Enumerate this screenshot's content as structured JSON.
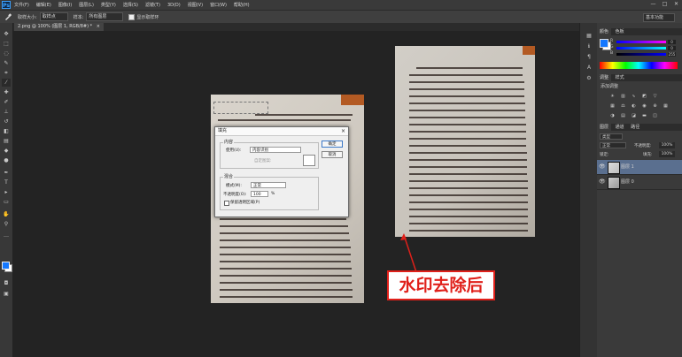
{
  "app": {
    "logo": "Ps"
  },
  "menubar": [
    "文件(F)",
    "编辑(E)",
    "图像(I)",
    "图层(L)",
    "类型(Y)",
    "选择(S)",
    "滤镜(T)",
    "3D(D)",
    "视图(V)",
    "窗口(W)",
    "帮助(H)"
  ],
  "window_controls": {
    "minimize": "—",
    "restore": "□",
    "close": "✕"
  },
  "options_bar": {
    "tool_icon": "eyedropper-icon",
    "sample_size_label": "取样大小:",
    "sample_size_value": "取样点",
    "sample_label": "样本:",
    "sample_value": "所有图层",
    "show_ring_label": "显示取样环",
    "workspace": "基本功能"
  },
  "document_tab": {
    "title": "2.png @ 100% (图层 1, RGB/8#) *",
    "close": "×"
  },
  "fill_dialog": {
    "title": "填充",
    "close": "×",
    "content_group": "内容",
    "use_label": "使用(U):",
    "use_value": "内容识别",
    "custom_pattern_label": "自定图案:",
    "blend_group": "混合",
    "mode_label": "模式(M):",
    "mode_value": "正常",
    "opacity_label": "不透明度(O):",
    "opacity_value": "100",
    "opacity_unit": "%",
    "preserve_label": "保留透明区域(P)",
    "ok_button": "确定",
    "cancel_button": "取消"
  },
  "color_panel": {
    "tabs": [
      "颜色",
      "色板"
    ],
    "channels": [
      {
        "label": "R",
        "value": "0"
      },
      {
        "label": "G",
        "value": "0"
      },
      {
        "label": "B",
        "value": "255"
      }
    ]
  },
  "adjustments_panel": {
    "tabs": [
      "调整",
      "样式"
    ],
    "title": "添加调整"
  },
  "layers_panel": {
    "tabs": [
      "图层",
      "通道",
      "路径"
    ],
    "kind_filter": "类型",
    "blend_mode": "正常",
    "opacity_label": "不透明度:",
    "opacity_value": "100%",
    "lock_label": "锁定:",
    "fill_label": "填充:",
    "fill_value": "100%",
    "layers": [
      {
        "name": "图层 1",
        "selected": true
      },
      {
        "name": "图层 0",
        "selected": false
      }
    ]
  },
  "annotation": {
    "text": "水印去除后",
    "color": "#e0201a"
  },
  "colors": {
    "foreground": "#1478ff",
    "background": "#ffffff",
    "accent": "#e0201a"
  }
}
